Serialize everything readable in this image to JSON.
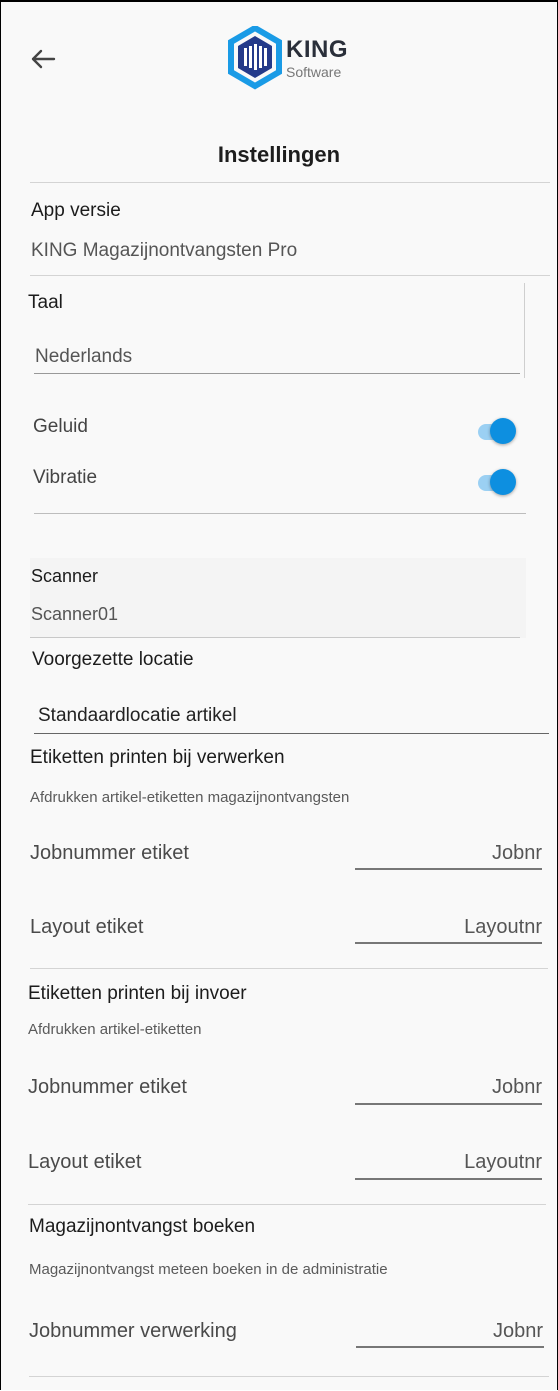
{
  "header": {
    "back_icon": "arrow-left-icon",
    "logo_text": "KING",
    "logo_sub": "Software",
    "title": "Instellingen"
  },
  "app_version": {
    "label": "App versie",
    "value": "KING Magazijnontvangsten Pro"
  },
  "language": {
    "label": "Taal",
    "value": "Nederlands"
  },
  "toggles": {
    "sound_label": "Geluid",
    "sound_on": true,
    "vibration_label": "Vibratie",
    "vibration_on": true,
    "accent": "#0d8fe0"
  },
  "scanner": {
    "label": "Scanner",
    "value": "Scanner01"
  },
  "default_location": {
    "label": "Voorgezette locatie",
    "value": "Standaardlocatie artikel"
  },
  "print_on_processing": {
    "title": "Etiketten printen bij verwerken",
    "description": "Afdrukken artikel-etiketten magazijnontvangsten",
    "job_label": "Jobnummer etiket",
    "job_placeholder": "Jobnr",
    "layout_label": "Layout etiket",
    "layout_placeholder": "Layoutnr"
  },
  "print_on_input": {
    "title": "Etiketten printen bij invoer",
    "description": "Afdrukken artikel-etiketten",
    "job_label": "Jobnummer etiket",
    "job_placeholder": "Jobnr",
    "layout_label": "Layout etiket",
    "layout_placeholder": "Layoutnr"
  },
  "book_receipt": {
    "title": "Magazijnontvangst boeken",
    "description": "Magazijnontvangst meteen boeken in de administratie",
    "job_label": "Jobnummer verwerking",
    "job_placeholder": "Jobnr"
  }
}
